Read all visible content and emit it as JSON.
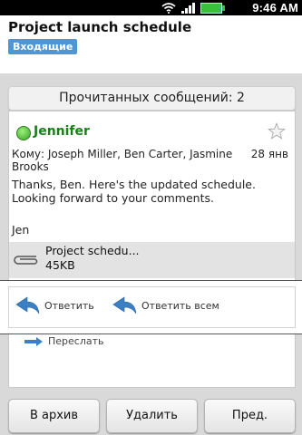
{
  "status_bar": {
    "time": "9:46 AM"
  },
  "header": {
    "subject": "Project launch schedule",
    "folder_tag": "Входящие"
  },
  "read_messages": "Прочитанных сообщений: 2",
  "message": {
    "sender": "Jennifer",
    "to_line": "Кому: Joseph Miller, Ben Carter, Jasmine Brooks",
    "date": "28 янв",
    "body_line1": "Thanks, Ben. Here's the updated schedule.",
    "body_line2": "Looking forward to your comments.",
    "signature": "Jen",
    "attachment": {
      "name": "Project schedu...",
      "size": "45KB"
    }
  },
  "actions": {
    "reply": "Ответить",
    "reply_all": "Ответить всем",
    "forward": "Переслать"
  },
  "bottom_buttons": {
    "archive": "В архив",
    "delete": "Удалить",
    "prev": "Пред."
  },
  "colors": {
    "sender": "#1a7f1a",
    "tag": "#4f96d6",
    "reply_arrow": "#3b7fc4"
  }
}
